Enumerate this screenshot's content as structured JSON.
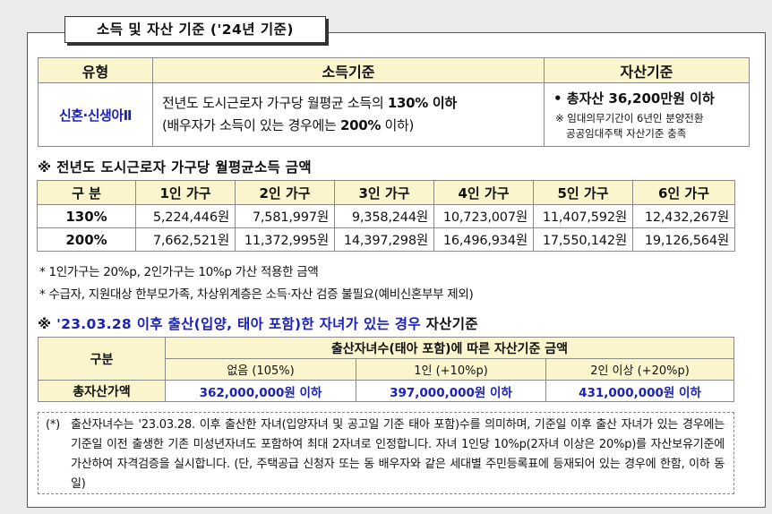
{
  "title": "소득 및 자산 기준 ('24년 기준)",
  "table1": {
    "headers": [
      "유형",
      "소득기준",
      "자산기준"
    ],
    "type": "신혼·신생아Ⅱ",
    "income_line1": "전년도 도시근로자 가구당 월평균 소득의 ",
    "income_line1_bold": "130% 이하",
    "income_line2": "(배우자가 소득이 있는 경우에는 ",
    "income_line2_bold": "200%",
    "income_line2_end": " 이하)",
    "asset_main": "• 총자산 36,200만원 이하",
    "asset_note_line1": "※ 임대의무기간이 6년인 분양전환",
    "asset_note_line2": "공공임대주택 자산기준 충족"
  },
  "section2_title": "※ 전년도 도시근로자 가구당 월평균소득 금액",
  "table2": {
    "headers": [
      "구 분",
      "1인 가구",
      "2인 가구",
      "3인 가구",
      "4인 가구",
      "5인 가구",
      "6인 가구"
    ],
    "rows": [
      {
        "label": "130%",
        "values": [
          "5,224,446원",
          "7,581,997원",
          "9,358,244원",
          "10,723,007원",
          "11,407,592원",
          "12,432,267원"
        ]
      },
      {
        "label": "200%",
        "values": [
          "7,662,521원",
          "11,372,995원",
          "14,397,298원",
          "16,496,934원",
          "17,550,142원",
          "19,126,564원"
        ]
      }
    ]
  },
  "bullets": [
    "* 1인가구는 20%p, 2인가구는 10%p 가산 적용한 금액",
    "* 수급자, 지원대상 한부모가족, 차상위계층은 소득·자산 검증 불필요(예비신혼부부 제외)"
  ],
  "section3": {
    "prefix": "※ ",
    "blue_text": "'23.03.28 이후 출산(입양, 태아 포함)한 자녀가 있는 경우",
    "suffix": " 자산기준"
  },
  "table3": {
    "corner": "구분",
    "group_header": "출산자녀수(태아 포함)에 따른 자산기준 금액",
    "sub_headers": [
      "없음 (105%)",
      "1인 (+10%p)",
      "2인 이상 (+20%p)"
    ],
    "row_label": "총자산가액",
    "values": [
      "362,000,000원 이하",
      "397,000,000원 이하",
      "431,000,000원 이하"
    ]
  },
  "note": {
    "mark": "(*)",
    "text": "출산자녀수는 '23.03.28. 이후 출산한 자녀(입양자녀 및 공고일 기준 태아 포함)수를 의미하며, 기준일 이후 출산 자녀가 있는 경우에는 기준일 이전 출생한 기존 미성년자녀도 포함하여 최대 2자녀로 인정합니다. 자녀 1인당 10%p(2자녀 이상은 20%p)를 자산보유기준에 가산하여 자격검증을 실시합니다. (단, 주택공급 신청자 또는 동 배우자와 같은 세대별 주민등록표에 등재되어 있는 경우에 한함, 이하 동일)"
  },
  "colors": {
    "header_yellow": "#fbf5cd",
    "highlight_blue": "#1c22b8"
  }
}
